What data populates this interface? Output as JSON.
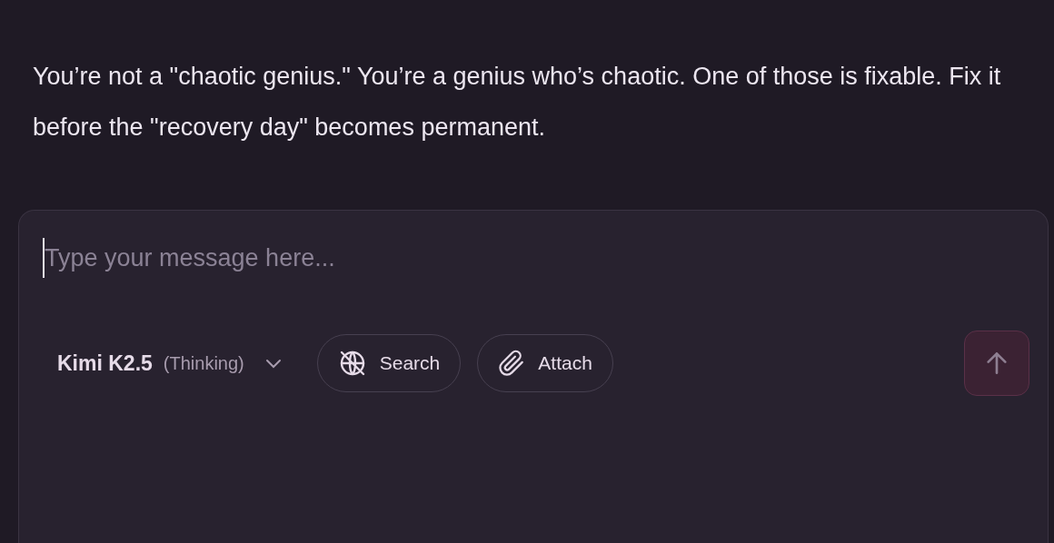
{
  "message": {
    "text": "You’re not a \"chaotic genius.\" You’re a genius who’s chaotic. One of those is fixable. Fix it before the \"recovery day\" becomes permanent."
  },
  "composer": {
    "placeholder": "Type your message here...",
    "model": {
      "name": "Kimi K2.5",
      "mode": "(Thinking)"
    },
    "tools": [
      {
        "kind": "search",
        "label": "Search",
        "on": false
      },
      {
        "kind": "attach",
        "label": "Attach"
      }
    ],
    "send": {
      "disabled": true
    }
  }
}
